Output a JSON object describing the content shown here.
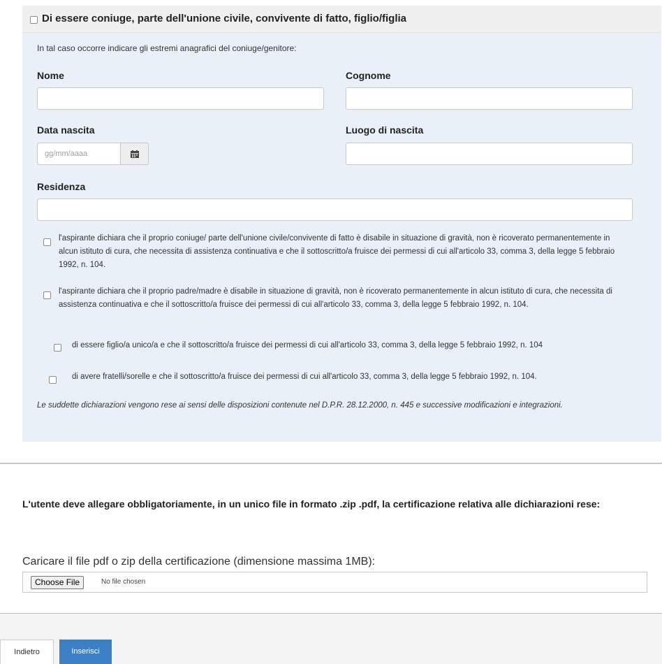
{
  "section": {
    "title": "Di essere coniuge, parte dell'unione civile, convivente di fatto, figlio/figlia",
    "intro": "In tal caso occorre indicare gli estremi anagrafici del coniuge/genitore:",
    "fields": {
      "nome_label": "Nome",
      "cognome_label": "Cognome",
      "data_nascita_label": "Data nascita",
      "data_nascita_placeholder": "gg/mm/aaaa",
      "luogo_nascita_label": "Luogo di nascita",
      "residenza_label": "Residenza"
    },
    "options": [
      "l'aspirante dichiara che il proprio coniuge/ parte dell'unione civile/convivente di fatto è disabile in situazione di gravità, non è ricoverato permanentemente in alcun istituto di cura, che necessita di assistenza continuativa e che il sottoscritto/a fruisce dei permessi di cui all'articolo 33, comma 3, della legge 5 febbraio 1992, n. 104.",
      "l'aspirante dichiara che il proprio padre/madre è disabile in situazione di gravità, non è ricoverato permanentemente in alcun istituto di cura, che necessita di assistenza continuativa e che il sottoscritto/a fruisce dei permessi di cui all'articolo 33, comma 3, della legge 5 febbraio 1992, n. 104.",
      "di essere figlio/a unico/a e che il sottoscritto/a fruisce dei permessi di cui all'articolo 33, comma 3, della legge 5 febbraio 1992, n. 104",
      "di avere fratelli/sorelle e che il sottoscritto/a fruisce dei permessi di cui all'articolo 33, comma 3, della legge 5 febbraio 1992, n. 104."
    ],
    "note": "Le suddette dichiarazioni vengono rese ai sensi delle disposizioni contenute nel D.P.R. 28.12.2000, n. 445 e successive modificazioni e integrazioni."
  },
  "upload": {
    "title": "L'utente deve allegare obbligatoriamente, in un unico file in formato .zip .pdf, la certificazione relativa alle dichiarazioni rese:",
    "label": "Caricare il file pdf o zip della certificazione (dimensione massima 1MB):",
    "choose_label": "Choose File",
    "no_file_text": "No file chosen"
  },
  "footer": {
    "back_label": "Indietro",
    "insert_label": "Inserisci"
  },
  "colors": {
    "section_bg": "#e9f0f8",
    "primary_button": "#3b7fc4"
  },
  "icons": {
    "calendar": "calendar-icon"
  }
}
